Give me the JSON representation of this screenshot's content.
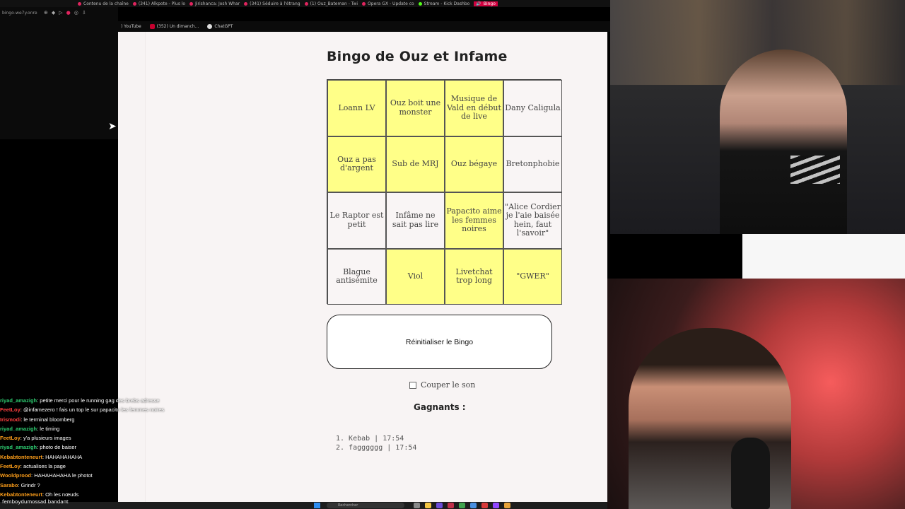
{
  "browser": {
    "tabs": [
      {
        "label": "Contenu de la chaîne"
      },
      {
        "label": "(341) Alkpote - Plus lo"
      },
      {
        "label": "Jirishanca: Josh Whar"
      },
      {
        "label": "(341) Séduire à l'étrang"
      },
      {
        "label": "(1) Ouz_Bateman - Twi"
      },
      {
        "label": "Opera GX - Update co"
      },
      {
        "label": "Stream - Kick Dashbo"
      },
      {
        "label": "Bingo"
      }
    ],
    "side_url": "bingo-we7y.onre",
    "bookmarks": [
      {
        "label": ") YouTube"
      },
      {
        "label": "(352) Un dimanch..."
      },
      {
        "label": "ChatGPT"
      }
    ]
  },
  "bingo": {
    "title": "Bingo de Ouz et Infame",
    "cells": [
      {
        "text": "Loann LV",
        "checked": true
      },
      {
        "text": "Ouz boit une monster",
        "checked": true
      },
      {
        "text": "Musique de Vald en début de live",
        "checked": true
      },
      {
        "text": "Dany Caligula",
        "checked": false
      },
      {
        "text": "Ouz a pas d'argent",
        "checked": true
      },
      {
        "text": "Sub de MRJ",
        "checked": true
      },
      {
        "text": "Ouz bégaye",
        "checked": true
      },
      {
        "text": "Bretonphobie",
        "checked": false
      },
      {
        "text": "Le Raptor est petit",
        "checked": false
      },
      {
        "text": "Infâme ne sait pas lire",
        "checked": false
      },
      {
        "text": "Papacito aime les femmes noires",
        "checked": true
      },
      {
        "text": "\"Alice Cordier je l'aie baisée hein, faut l'savoir\"",
        "checked": false
      },
      {
        "text": "Blague antisémite",
        "checked": false
      },
      {
        "text": "Viol",
        "checked": true
      },
      {
        "text": "Livetchat trop long",
        "checked": true
      },
      {
        "text": "\"GWER\"",
        "checked": true
      }
    ],
    "reset_label": "Réinitialiser le Bingo",
    "mute_label": "Couper le son",
    "mute_checked": false,
    "winners_title": "Gagnants :",
    "winners": [
      "1. Kebab | 17:54",
      "2. fagggggg | 17:54"
    ]
  },
  "chat": [
    {
      "user": "riyad_amazigh",
      "color": "#2ecc71",
      "text": "petite merci pour le running gag des brebs adresse"
    },
    {
      "user": "FeetLoy",
      "color": "#ff4040",
      "text": "@infamezero ! fais un top le sur papacito les femmes noires"
    },
    {
      "user": "Irismodi",
      "color": "#ff4040",
      "text": "le terminal bloomberg"
    },
    {
      "user": "riyad_amazigh",
      "color": "#2ecc71",
      "text": "le timing"
    },
    {
      "user": "FeetLoy",
      "color": "#ff9f1a",
      "text": "y'a plusieurs images"
    },
    {
      "user": "riyad_amazigh",
      "color": "#2ecc71",
      "text": "photo de baiser"
    },
    {
      "user": "Kebabtonteneurt",
      "color": "#ff9f1a",
      "text": "HAHAHAHAHA"
    },
    {
      "user": "FeetLoy",
      "color": "#ff9f1a",
      "text": "actualises la page"
    },
    {
      "user": "Wooldprood",
      "color": "#ff9f1a",
      "text": "HAHAHAHAHA le photot"
    },
    {
      "user": "Sarabo",
      "color": "#ff9f1a",
      "text": "Grindr ?"
    },
    {
      "user": "Kebabtonteneurt",
      "color": "#ff9f1a",
      "text": "Oh les nœuds"
    }
  ],
  "taskbar": {
    "user": "femboydumossad bandant",
    "search_placeholder": "Rechercher"
  },
  "colors": {
    "checked_cell": "#ffff88",
    "unchecked_cell": "#f9f5f5",
    "page_bg": "#f8f4f4",
    "accent_tab": "#d1003f"
  }
}
